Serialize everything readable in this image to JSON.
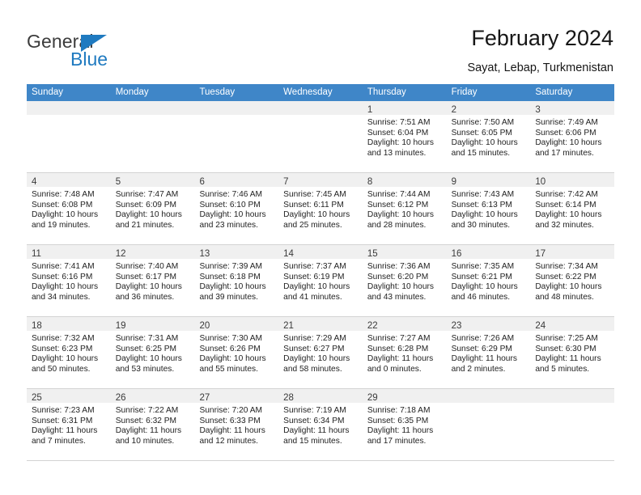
{
  "brand": {
    "word_one": "General",
    "word_two": "Blue",
    "accent_color": "#1f7ac0",
    "triangle_icon": "brand-triangle-icon"
  },
  "header": {
    "title": "February 2024",
    "subtitle": "Sayat, Lebap, Turkmenistan"
  },
  "calendar": {
    "header_bg": "#3f86c8",
    "weekdays": [
      "Sunday",
      "Monday",
      "Tuesday",
      "Wednesday",
      "Thursday",
      "Friday",
      "Saturday"
    ],
    "weeks": [
      [
        {
          "day": "",
          "lines": []
        },
        {
          "day": "",
          "lines": []
        },
        {
          "day": "",
          "lines": []
        },
        {
          "day": "",
          "lines": []
        },
        {
          "day": "1",
          "lines": [
            "Sunrise: 7:51 AM",
            "Sunset: 6:04 PM",
            "Daylight: 10 hours",
            "and 13 minutes."
          ]
        },
        {
          "day": "2",
          "lines": [
            "Sunrise: 7:50 AM",
            "Sunset: 6:05 PM",
            "Daylight: 10 hours",
            "and 15 minutes."
          ]
        },
        {
          "day": "3",
          "lines": [
            "Sunrise: 7:49 AM",
            "Sunset: 6:06 PM",
            "Daylight: 10 hours",
            "and 17 minutes."
          ]
        }
      ],
      [
        {
          "day": "4",
          "lines": [
            "Sunrise: 7:48 AM",
            "Sunset: 6:08 PM",
            "Daylight: 10 hours",
            "and 19 minutes."
          ]
        },
        {
          "day": "5",
          "lines": [
            "Sunrise: 7:47 AM",
            "Sunset: 6:09 PM",
            "Daylight: 10 hours",
            "and 21 minutes."
          ]
        },
        {
          "day": "6",
          "lines": [
            "Sunrise: 7:46 AM",
            "Sunset: 6:10 PM",
            "Daylight: 10 hours",
            "and 23 minutes."
          ]
        },
        {
          "day": "7",
          "lines": [
            "Sunrise: 7:45 AM",
            "Sunset: 6:11 PM",
            "Daylight: 10 hours",
            "and 25 minutes."
          ]
        },
        {
          "day": "8",
          "lines": [
            "Sunrise: 7:44 AM",
            "Sunset: 6:12 PM",
            "Daylight: 10 hours",
            "and 28 minutes."
          ]
        },
        {
          "day": "9",
          "lines": [
            "Sunrise: 7:43 AM",
            "Sunset: 6:13 PM",
            "Daylight: 10 hours",
            "and 30 minutes."
          ]
        },
        {
          "day": "10",
          "lines": [
            "Sunrise: 7:42 AM",
            "Sunset: 6:14 PM",
            "Daylight: 10 hours",
            "and 32 minutes."
          ]
        }
      ],
      [
        {
          "day": "11",
          "lines": [
            "Sunrise: 7:41 AM",
            "Sunset: 6:16 PM",
            "Daylight: 10 hours",
            "and 34 minutes."
          ]
        },
        {
          "day": "12",
          "lines": [
            "Sunrise: 7:40 AM",
            "Sunset: 6:17 PM",
            "Daylight: 10 hours",
            "and 36 minutes."
          ]
        },
        {
          "day": "13",
          "lines": [
            "Sunrise: 7:39 AM",
            "Sunset: 6:18 PM",
            "Daylight: 10 hours",
            "and 39 minutes."
          ]
        },
        {
          "day": "14",
          "lines": [
            "Sunrise: 7:37 AM",
            "Sunset: 6:19 PM",
            "Daylight: 10 hours",
            "and 41 minutes."
          ]
        },
        {
          "day": "15",
          "lines": [
            "Sunrise: 7:36 AM",
            "Sunset: 6:20 PM",
            "Daylight: 10 hours",
            "and 43 minutes."
          ]
        },
        {
          "day": "16",
          "lines": [
            "Sunrise: 7:35 AM",
            "Sunset: 6:21 PM",
            "Daylight: 10 hours",
            "and 46 minutes."
          ]
        },
        {
          "day": "17",
          "lines": [
            "Sunrise: 7:34 AM",
            "Sunset: 6:22 PM",
            "Daylight: 10 hours",
            "and 48 minutes."
          ]
        }
      ],
      [
        {
          "day": "18",
          "lines": [
            "Sunrise: 7:32 AM",
            "Sunset: 6:23 PM",
            "Daylight: 10 hours",
            "and 50 minutes."
          ]
        },
        {
          "day": "19",
          "lines": [
            "Sunrise: 7:31 AM",
            "Sunset: 6:25 PM",
            "Daylight: 10 hours",
            "and 53 minutes."
          ]
        },
        {
          "day": "20",
          "lines": [
            "Sunrise: 7:30 AM",
            "Sunset: 6:26 PM",
            "Daylight: 10 hours",
            "and 55 minutes."
          ]
        },
        {
          "day": "21",
          "lines": [
            "Sunrise: 7:29 AM",
            "Sunset: 6:27 PM",
            "Daylight: 10 hours",
            "and 58 minutes."
          ]
        },
        {
          "day": "22",
          "lines": [
            "Sunrise: 7:27 AM",
            "Sunset: 6:28 PM",
            "Daylight: 11 hours",
            "and 0 minutes."
          ]
        },
        {
          "day": "23",
          "lines": [
            "Sunrise: 7:26 AM",
            "Sunset: 6:29 PM",
            "Daylight: 11 hours",
            "and 2 minutes."
          ]
        },
        {
          "day": "24",
          "lines": [
            "Sunrise: 7:25 AM",
            "Sunset: 6:30 PM",
            "Daylight: 11 hours",
            "and 5 minutes."
          ]
        }
      ],
      [
        {
          "day": "25",
          "lines": [
            "Sunrise: 7:23 AM",
            "Sunset: 6:31 PM",
            "Daylight: 11 hours",
            "and 7 minutes."
          ]
        },
        {
          "day": "26",
          "lines": [
            "Sunrise: 7:22 AM",
            "Sunset: 6:32 PM",
            "Daylight: 11 hours",
            "and 10 minutes."
          ]
        },
        {
          "day": "27",
          "lines": [
            "Sunrise: 7:20 AM",
            "Sunset: 6:33 PM",
            "Daylight: 11 hours",
            "and 12 minutes."
          ]
        },
        {
          "day": "28",
          "lines": [
            "Sunrise: 7:19 AM",
            "Sunset: 6:34 PM",
            "Daylight: 11 hours",
            "and 15 minutes."
          ]
        },
        {
          "day": "29",
          "lines": [
            "Sunrise: 7:18 AM",
            "Sunset: 6:35 PM",
            "Daylight: 11 hours",
            "and 17 minutes."
          ]
        },
        {
          "day": "",
          "lines": []
        },
        {
          "day": "",
          "lines": []
        }
      ]
    ]
  }
}
